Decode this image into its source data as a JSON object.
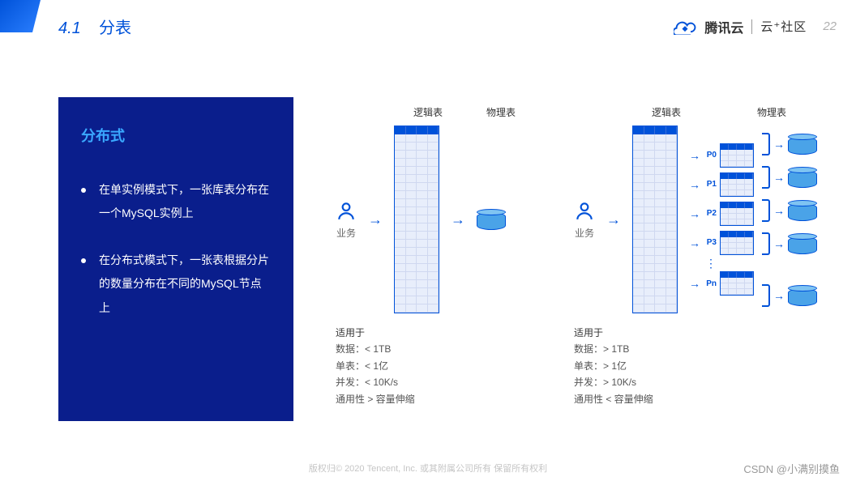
{
  "header": {
    "section_num": "4.1",
    "section_title": "分表",
    "brand_main": "腾讯云",
    "brand_sub": "云⁺社区",
    "page": "22"
  },
  "panel": {
    "title": "分布式",
    "bullets": [
      "在单实例模式下，一张库表分布在一个MySQL实例上",
      "在分布式模式下，一张表根据分片的数量分布在不同的MySQL节点上"
    ]
  },
  "diagram": {
    "biz_label": "业务",
    "logical_table": "逻辑表",
    "physical_table": "物理表",
    "partitions": [
      "P0",
      "P1",
      "P2",
      "P3",
      "Pn"
    ]
  },
  "stats_left": {
    "title": "适用于",
    "rows": [
      "数据：< 1TB",
      "单表：< 1亿",
      "并发：< 10K/s",
      "通用性 > 容量伸缩"
    ]
  },
  "stats_right": {
    "title": "适用于",
    "rows": [
      "数据：> 1TB",
      "单表：> 1亿",
      "并发：> 10K/s",
      "通用性 < 容量伸缩"
    ]
  },
  "footer": "版权归© 2020 Tencent, Inc. 或其附属公司所有 保留所有权利",
  "watermark": "CSDN @小满别摸鱼"
}
